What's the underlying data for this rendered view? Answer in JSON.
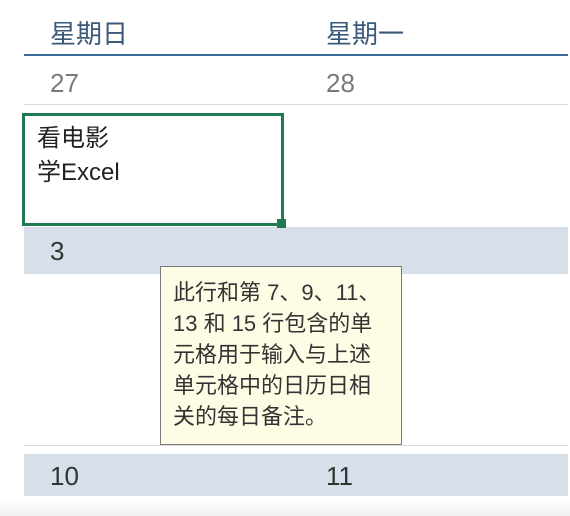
{
  "headers": [
    "星期日",
    "星期一"
  ],
  "rows": [
    {
      "dates": [
        "27",
        "28"
      ],
      "notes": [
        "看电影",
        "学Excel"
      ]
    },
    {
      "dates": [
        "3",
        ""
      ]
    },
    {
      "dates": [
        "10",
        "11"
      ]
    }
  ],
  "tooltip": {
    "text": "此行和第 7、9、11、13 和 15 行包含的单元格用于输入与上述单元格中的日历日相关的每日备注。"
  }
}
